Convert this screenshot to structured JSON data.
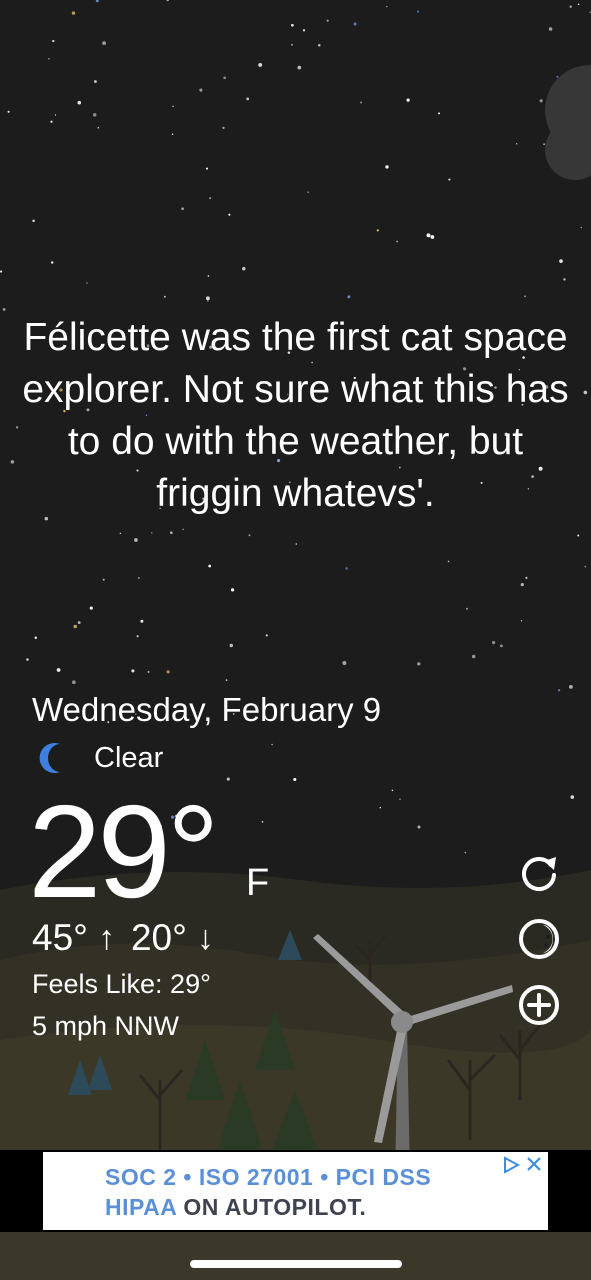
{
  "fact": {
    "text": "Félicette was the first cat space explorer. Not sure what this has to do with the weather, but friggin whatevs'."
  },
  "weather": {
    "date": "Wednesday, February 9",
    "condition": "Clear",
    "condition_icon": "moon-icon",
    "temperature": "29°",
    "unit": "F",
    "high": "45°",
    "high_arrow": "↑",
    "low": "20°",
    "low_arrow": "↓",
    "feels_like": "Feels Like: 29°",
    "wind": "5 mph NNW"
  },
  "actions": [
    {
      "name": "refresh",
      "icon": "refresh-icon"
    },
    {
      "name": "theme",
      "icon": "moon-phase-icon"
    },
    {
      "name": "add",
      "icon": "plus-circle-icon"
    }
  ],
  "ad": {
    "line1": "SOC 2 • ISO 27001 • PCI DSS",
    "line2_a": "HIPAA",
    "line2_b": " ON AUTOPILOT.",
    "choices_icon": "ad-choices-icon",
    "close_icon": "close-icon"
  },
  "colors": {
    "sky": "#1c1c1c",
    "ad_blue": "#5b8fd6",
    "moon": "#3f7fe0"
  }
}
